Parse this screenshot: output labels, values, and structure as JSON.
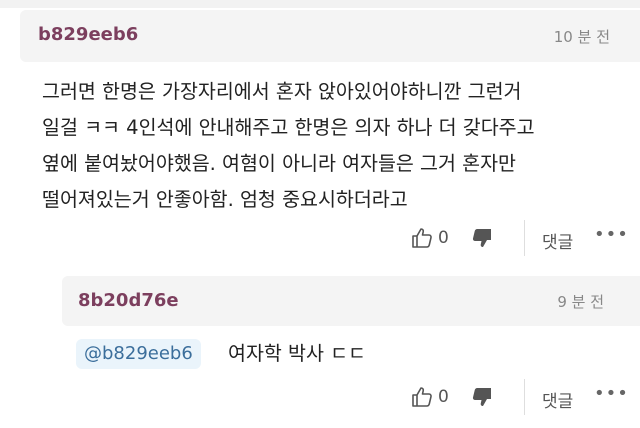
{
  "comment": {
    "username": "b829eeb6",
    "time": "10 분 전",
    "lines": [
      "그러면 한명은 가장자리에서 혼자 앉아있어야하니깐 그런거",
      "일걸 ㅋㅋ 4인석에 안내해주고 한명은 의자 하나 더 갖다주고",
      "옆에 붙여놨어야했음. 여혐이 아니라 여자들은 그거 혼자만",
      "떨어져있는거 안좋아함. 엄청 중요시하더라고"
    ],
    "like_count": "0",
    "reply_label": "댓글",
    "more_label": "•••"
  },
  "reply": {
    "username": "8b20d76e",
    "time": "9 분 전",
    "mention": "@b829eeb6",
    "text": "여자학 박사 ㄷㄷ",
    "like_count": "0",
    "reply_label": "댓글",
    "more_label": "•••"
  },
  "icons": [
    "thumbs-up-icon",
    "thumbs-down-icon",
    "more-icon"
  ]
}
